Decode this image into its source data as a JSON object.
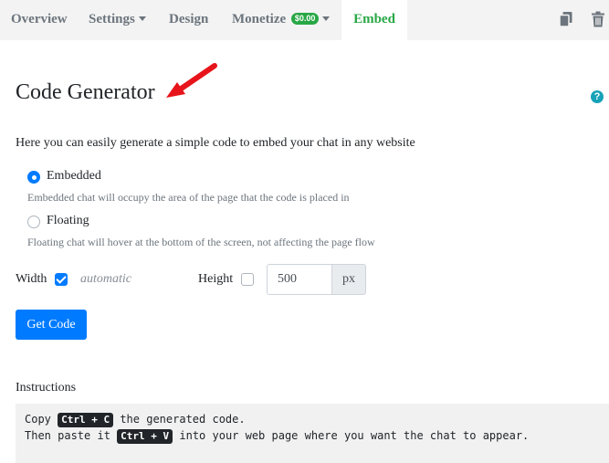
{
  "nav": {
    "tabs": [
      {
        "label": "Overview"
      },
      {
        "label": "Settings"
      },
      {
        "label": "Design"
      },
      {
        "label": "Monetize",
        "badge": "$0.00"
      },
      {
        "label": "Embed",
        "active": true
      }
    ],
    "tools": [
      "copy-icon",
      "trash-icon"
    ]
  },
  "page": {
    "title": "Code Generator",
    "help_icon": "?",
    "intro": "Here you can easily generate a simple code to embed your chat in any website"
  },
  "embed_options": [
    {
      "label": "Embedded",
      "hint": "Embedded chat will occupy the area of the page that the code is placed in",
      "selected": true
    },
    {
      "label": "Floating",
      "hint": "Floating chat will hover at the bottom of the screen, not affecting the page flow",
      "selected": false
    }
  ],
  "size": {
    "width_label": "Width",
    "width_automatic": true,
    "width_auto_text": "automatic",
    "height_label": "Height",
    "height_checked": false,
    "height_value": "500",
    "height_unit": "px"
  },
  "actions": {
    "get_code": "Get Code"
  },
  "instructions": {
    "title": "Instructions",
    "line1_pre": "Copy ",
    "line1_key": "Ctrl + C",
    "line1_post": " the generated code.",
    "line2_pre": "Then paste it ",
    "line2_key": "Ctrl + V",
    "line2_post": " into your web page where you want the chat to appear."
  },
  "colors": {
    "accent": "#007bff",
    "active_tab": "#28a745",
    "annotation_arrow": "#e8141b",
    "help": "#17a2b8"
  }
}
